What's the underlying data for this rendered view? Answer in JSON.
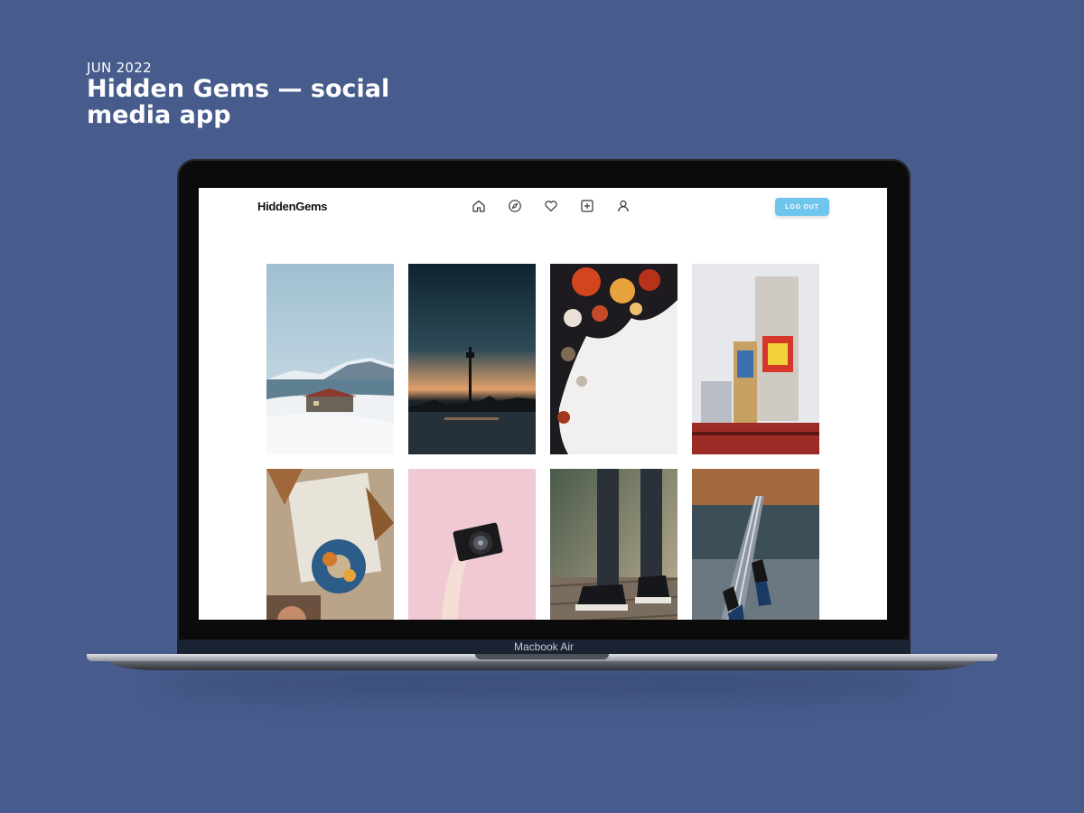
{
  "header": {
    "date": "JUN 2022",
    "title": "Hidden Gems — social media app"
  },
  "device": {
    "label": "Macbook Air"
  },
  "app": {
    "logo": "HiddenGems",
    "nav_icons": [
      "home-icon",
      "explore-icon",
      "heart-icon",
      "add-post-icon",
      "profile-icon"
    ],
    "logout_label": "LOG OUT",
    "accent_color": "#6fc6ec"
  },
  "feed": {
    "photos": [
      {
        "subject": "snowy coastal cabin"
      },
      {
        "subject": "sunset tower skyline"
      },
      {
        "subject": "abstract paint swirl"
      },
      {
        "subject": "pop art building mural"
      },
      {
        "subject": "scrunchie and painted portrait"
      },
      {
        "subject": "hand holding camera on pink"
      },
      {
        "subject": "converse sneakers on wood deck"
      },
      {
        "subject": "feet dangling over bridge"
      }
    ]
  }
}
